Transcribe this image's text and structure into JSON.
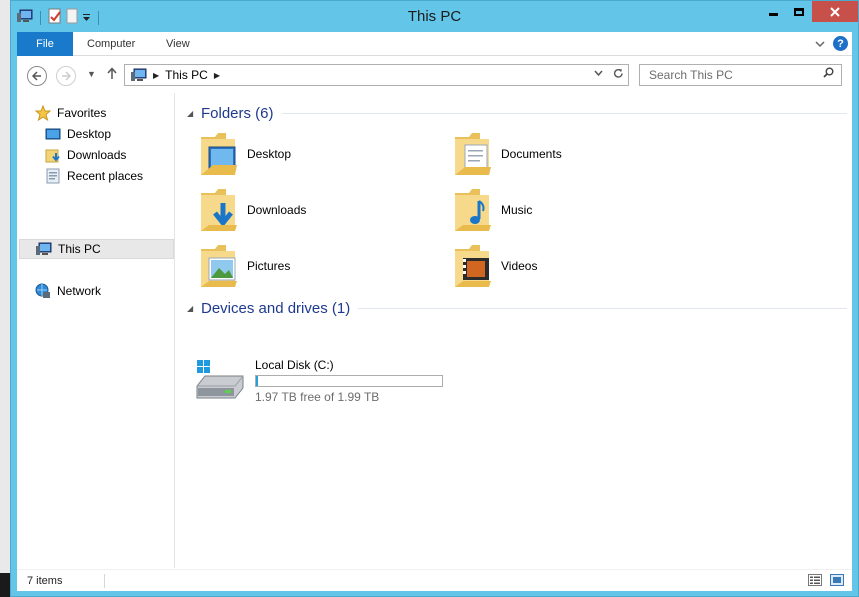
{
  "window": {
    "title": "This PC"
  },
  "ribbon": {
    "tabs": [
      "File",
      "Computer",
      "View"
    ]
  },
  "nav": {
    "path": [
      "This PC"
    ],
    "search_placeholder": "Search This PC"
  },
  "navpane": {
    "favorites": "Favorites",
    "favorites_items": [
      "Desktop",
      "Downloads",
      "Recent places"
    ],
    "this_pc": "This PC",
    "network": "Network"
  },
  "groups": {
    "folders_title": "Folders (6)",
    "folders": [
      "Desktop",
      "Documents",
      "Downloads",
      "Music",
      "Pictures",
      "Videos"
    ],
    "devices_title": "Devices and drives (1)",
    "drives": [
      {
        "name": "Local Disk (C:)",
        "free_text": "1.97 TB free of 1.99 TB",
        "used_fraction": 0.01
      }
    ]
  },
  "status": {
    "items": "7 items"
  },
  "colors": {
    "accent": "#1979ca",
    "frame": "#63c6e9",
    "close": "#c7504a",
    "group_title": "#1e3a8f"
  },
  "icons": {
    "desktop": "desktop-folder-icon",
    "documents": "documents-folder-icon",
    "downloads": "downloads-folder-icon",
    "music": "music-folder-icon",
    "pictures": "pictures-folder-icon",
    "videos": "videos-folder-icon",
    "drive": "local-disk-icon"
  }
}
